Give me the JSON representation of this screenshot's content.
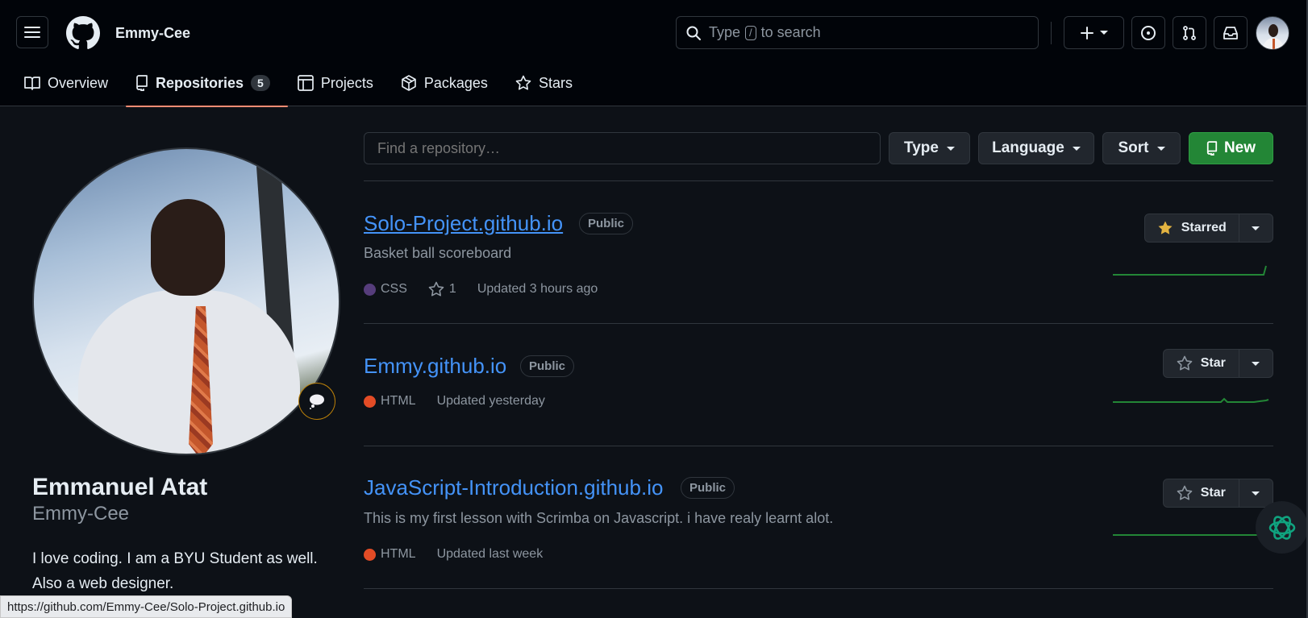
{
  "header": {
    "username": "Emmy-Cee",
    "search": {
      "prefix": "Type",
      "key": "/",
      "suffix": "to search"
    }
  },
  "tabs": [
    {
      "label": "Overview",
      "icon": "book-icon"
    },
    {
      "label": "Repositories",
      "icon": "repo-icon",
      "count": "5",
      "active": true
    },
    {
      "label": "Projects",
      "icon": "table-icon"
    },
    {
      "label": "Packages",
      "icon": "package-icon"
    },
    {
      "label": "Stars",
      "icon": "star-icon"
    }
  ],
  "profile": {
    "name": "Emmanuel Atat",
    "login": "Emmy-Cee",
    "bio": "I love coding. I am a BYU Student as well. Also a web designer."
  },
  "filters": {
    "find_placeholder": "Find a repository…",
    "type_label": "Type",
    "language_label": "Language",
    "sort_label": "Sort",
    "new_label": "New"
  },
  "repos": [
    {
      "name": "Solo-Project.github.io",
      "visibility": "Public",
      "description": "Basket ball scoreboard",
      "language": "CSS",
      "language_color": "#563d7c",
      "stars": "1",
      "updated": "Updated 3 hours ago",
      "star_label": "Starred",
      "starred": true
    },
    {
      "name": "Emmy.github.io",
      "visibility": "Public",
      "description": "",
      "language": "HTML",
      "language_color": "#e34c26",
      "updated": "Updated yesterday",
      "star_label": "Star",
      "starred": false
    },
    {
      "name": "JavaScript-Introduction.github.io",
      "visibility": "Public",
      "description": "This is my first lesson with Scrimba on Javascript. i have realy learnt alot.",
      "language": "HTML",
      "language_color": "#e34c26",
      "updated": "Updated last week",
      "star_label": "Star",
      "starred": false
    }
  ],
  "status_bar": {
    "url": "https://github.com/Emmy-Cee/Solo-Project.github.io"
  },
  "colors": {
    "accent_green": "#238636",
    "link_blue": "#4493f8",
    "tab_underline": "#fd8c73",
    "star_yellow": "#e3b341"
  }
}
